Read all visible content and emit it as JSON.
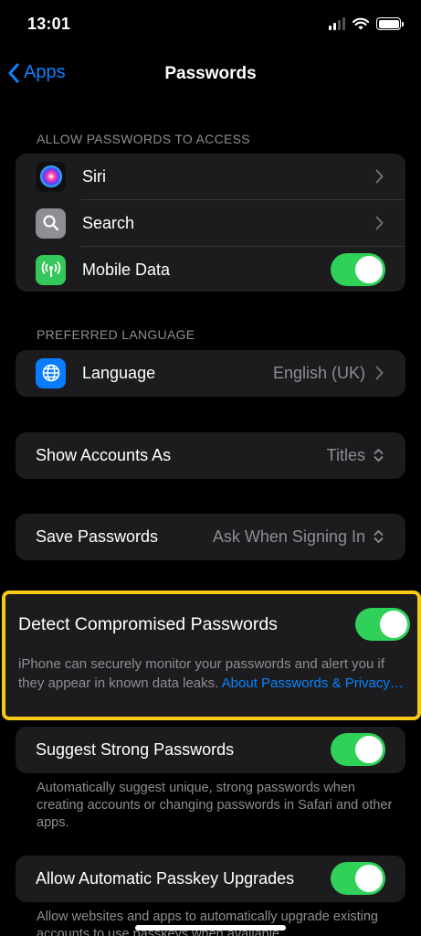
{
  "status": {
    "time": "13:01"
  },
  "nav": {
    "back_label": "Apps",
    "title": "Passwords"
  },
  "access": {
    "header": "ALLOW PASSWORDS TO ACCESS",
    "items": [
      {
        "label": "Siri",
        "icon": "siri-icon"
      },
      {
        "label": "Search",
        "icon": "search-icon"
      },
      {
        "label": "Mobile Data",
        "icon": "antenna-icon",
        "toggle": true
      }
    ]
  },
  "language": {
    "header": "PREFERRED LANGUAGE",
    "label": "Language",
    "value": "English (UK)",
    "icon": "globe-icon"
  },
  "show_accounts": {
    "label": "Show Accounts As",
    "value": "Titles"
  },
  "save_passwords": {
    "label": "Save Passwords",
    "value": "Ask When Signing In"
  },
  "detect": {
    "label": "Detect Compromised Passwords",
    "enabled": true,
    "description": "iPhone can securely monitor your passwords and alert you if they appear in known data leaks.",
    "link": "About Passwords & Privacy…"
  },
  "suggest": {
    "label": "Suggest Strong Passwords",
    "enabled": true,
    "description": "Automatically suggest unique, strong passwords when creating accounts or changing passwords in Safari and other apps."
  },
  "passkey": {
    "label": "Allow Automatic Passkey Upgrades",
    "enabled": true,
    "description": "Allow websites and apps to automatically upgrade existing accounts to use passkeys when available."
  },
  "colors": {
    "accent": "#0a84ff",
    "toggle_on": "#30d158",
    "highlight": "#f6c915",
    "background": "#000000",
    "cell": "#1c1c1e"
  }
}
